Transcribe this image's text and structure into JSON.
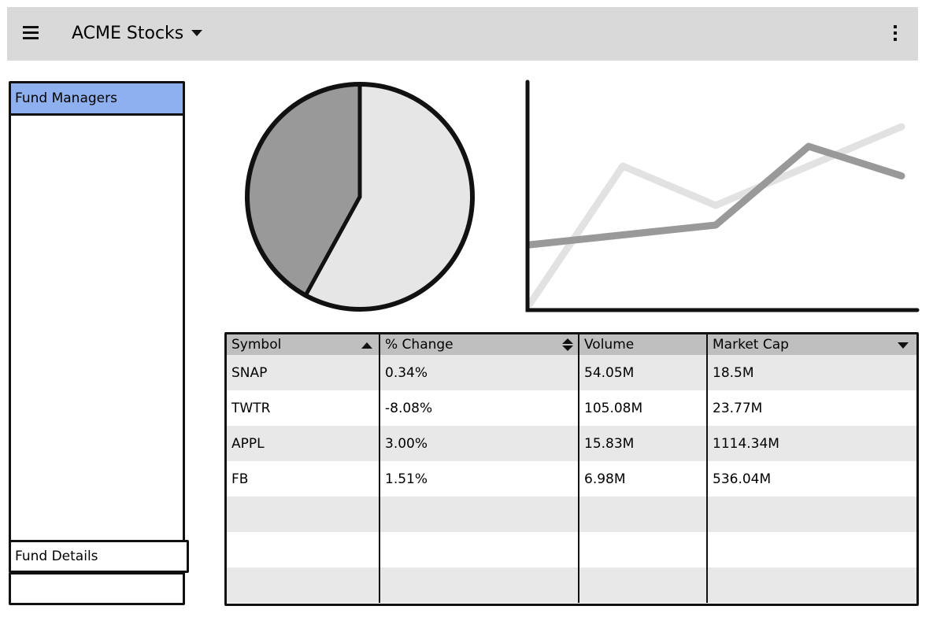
{
  "header": {
    "title": "ACME Stocks",
    "menu_icon": "hamburger-menu-icon",
    "dropdown_icon": "caret-down-icon",
    "more_icon": "kebab-menu-icon"
  },
  "sidebar": {
    "active_item": "Fund Managers",
    "details_label": "Fund Details",
    "active_color": "#8fb0ee"
  },
  "pie": {
    "chart_data": {
      "type": "pie",
      "values": [
        58,
        42
      ],
      "colors": [
        "#e6e6e6",
        "#999999"
      ]
    }
  },
  "line": {
    "chart_data": {
      "type": "line",
      "x": [
        1,
        2,
        3,
        4,
        5
      ],
      "series": [
        {
          "values": [
            0.0,
            0.7,
            0.5,
            0.7,
            0.9
          ],
          "color": "#e2e2e2"
        },
        {
          "values": [
            0.3,
            0.35,
            0.4,
            0.8,
            0.65
          ],
          "color": "#999999"
        }
      ],
      "ylim": [
        0,
        1
      ]
    }
  },
  "table": {
    "columns": [
      "Symbol",
      "% Change",
      "Volume",
      "Market Cap"
    ],
    "rows": [
      [
        "SNAP",
        "0.34%",
        "54.05M",
        "18.5M"
      ],
      [
        "TWTR",
        "-8.08%",
        "105.08M",
        "23.77M"
      ],
      [
        "APPL",
        "3.00%",
        "15.83M",
        "1114.34M"
      ],
      [
        "FB",
        "1.51%",
        "6.98M",
        "536.04M"
      ],
      [
        "",
        "",
        "",
        ""
      ],
      [
        "",
        "",
        "",
        ""
      ],
      [
        "",
        "",
        "",
        ""
      ]
    ]
  }
}
